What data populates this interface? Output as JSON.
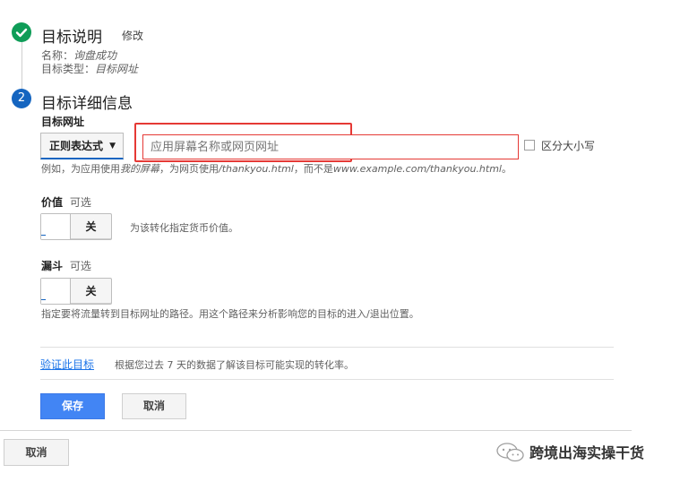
{
  "step1": {
    "title": "目标说明",
    "edit_label": "修改",
    "name_label": "名称：",
    "name_value": "询盘成功",
    "type_label": "目标类型：",
    "type_value": "目标网址"
  },
  "step2": {
    "number": "2",
    "title": "目标详细信息",
    "url_label": "目标网址",
    "match_type": "正则表达式",
    "url_placeholder": "应用屏幕名称或网页网址",
    "case_sensitive_label": "区分大小写",
    "hint_prefix": "例如，为应用使用",
    "hint_italic1": "我的屏幕",
    "hint_middle": "，为网页使用",
    "hint_italic2": "/thankyou.html",
    "hint_middle2": "，而不是",
    "hint_italic3": "www.example.com/thankyou.html",
    "hint_suffix": "。"
  },
  "value_section": {
    "label": "价值",
    "optional": "可选",
    "toggle_label": "关",
    "description": "为该转化指定货币价值。"
  },
  "funnel_section": {
    "label": "漏斗",
    "optional": "可选",
    "toggle_label": "关",
    "description": "指定要将流量转到目标网址的路径。用这个路径来分析影响您的目标的进入/退出位置。"
  },
  "verify": {
    "link_label": "验证此目标",
    "description": "根据您过去 7 天的数据了解该目标可能实现的转化率。"
  },
  "actions": {
    "save_label": "保存",
    "cancel_label": "取消",
    "outer_cancel_label": "取消"
  },
  "watermark": {
    "text": "跨境出海实操干货"
  },
  "colors": {
    "done_green": "#0f9d58",
    "step_blue": "#1565c0",
    "primary_button": "#4285f4",
    "highlight_red": "#e53935",
    "link_blue": "#1a73e8"
  }
}
